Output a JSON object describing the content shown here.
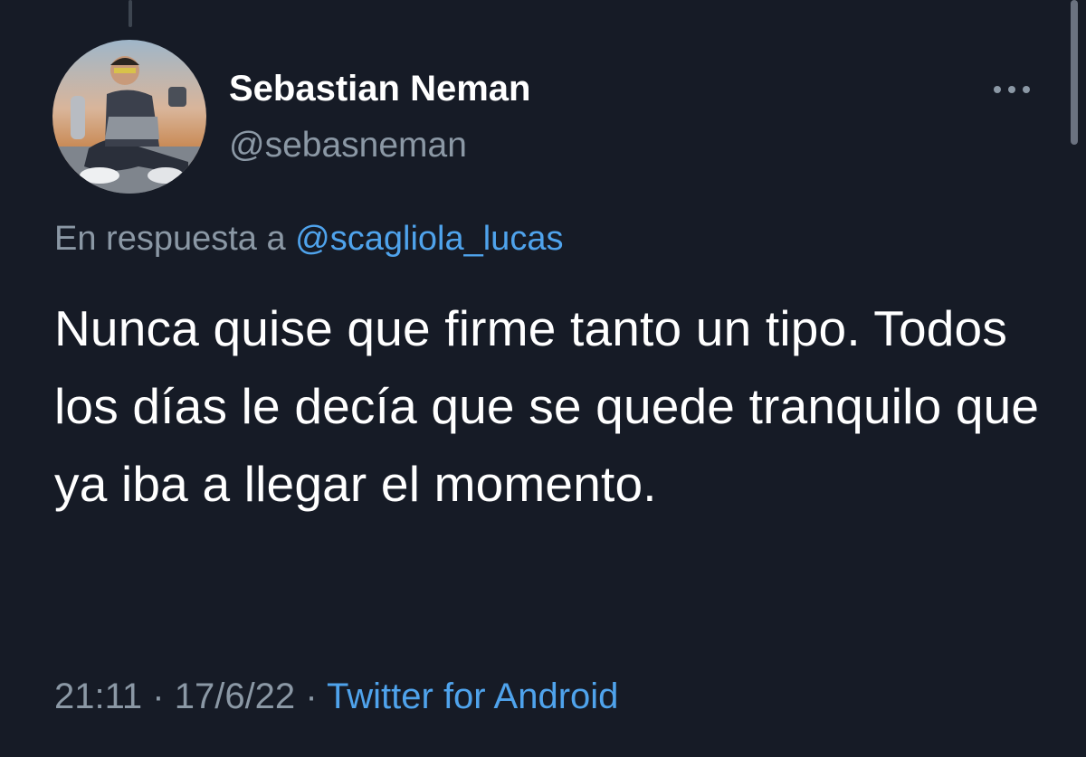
{
  "author": {
    "display_name": "Sebastian Neman",
    "handle": "@sebasneman",
    "avatar_icon": "user-avatar-photo"
  },
  "reply": {
    "prefix": "En respuesta a",
    "mention": "@scagliola_lucas"
  },
  "tweet": {
    "text": "Nunca quise que firme tanto un tipo. Todos los días le decía que se quede tranquilo que ya iba a llegar el momento."
  },
  "meta": {
    "time": "21:11",
    "date": "17/6/22",
    "separator": "·",
    "source": "Twitter for Android"
  },
  "icons": {
    "more": "more-options-icon"
  },
  "colors": {
    "background": "#161b26",
    "primary_text": "#ffffff",
    "secondary_text": "#8b98a5",
    "link": "#4fa3ec"
  }
}
